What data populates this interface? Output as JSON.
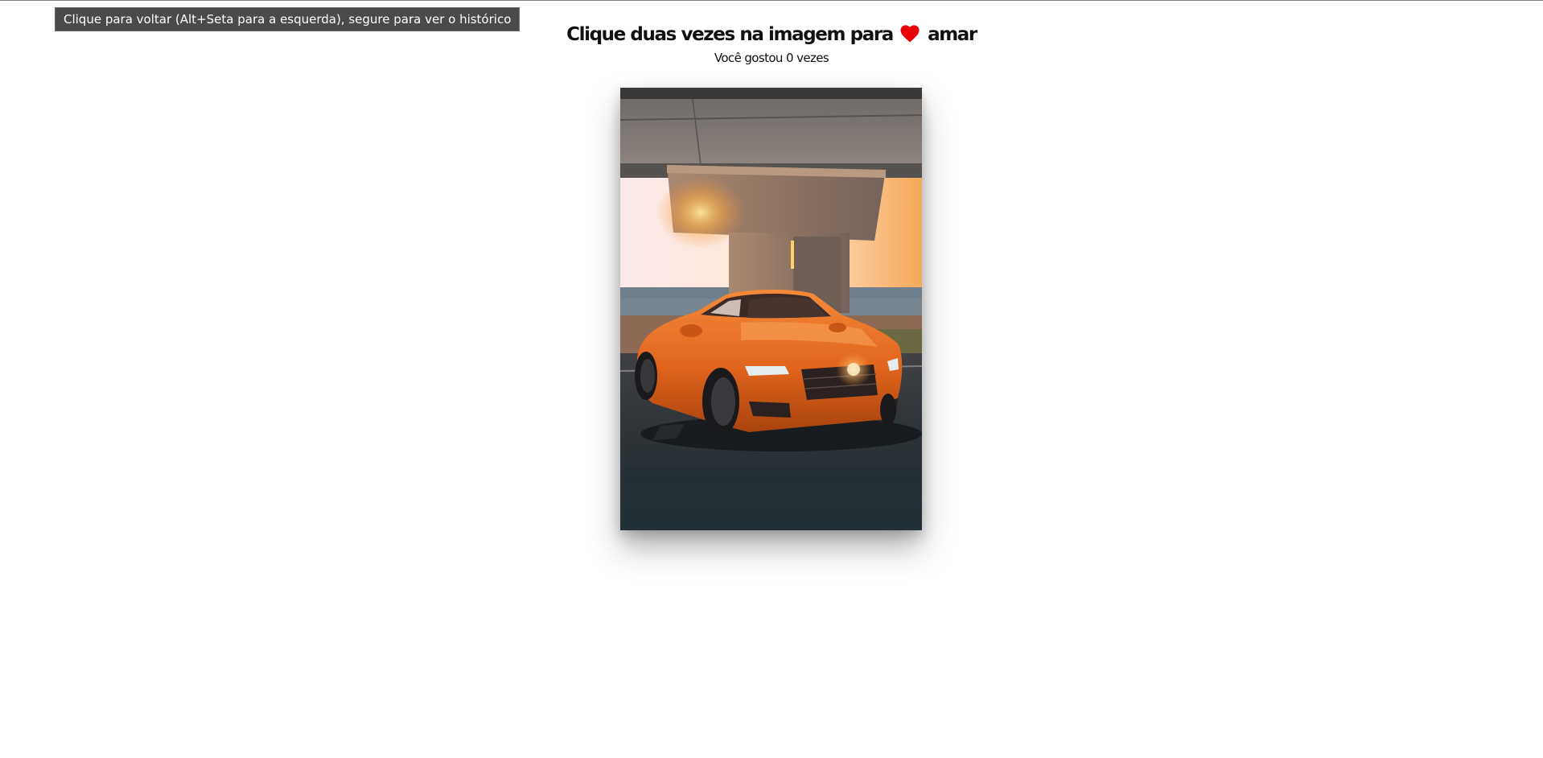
{
  "tooltip": {
    "text": "Clique para voltar (Alt+Seta para a esquerda), segure para ver o histórico"
  },
  "header": {
    "title_before": "Clique duas vezes na imagem para",
    "title_after": "amar",
    "heart_icon": "heart-icon",
    "heart_color": "#e8000b",
    "like_text": "Você gostou 0 vezes"
  },
  "photo": {
    "subject": "orange coupe parked under a concrete bridge at sunset",
    "accent_color": "#e8661a"
  }
}
